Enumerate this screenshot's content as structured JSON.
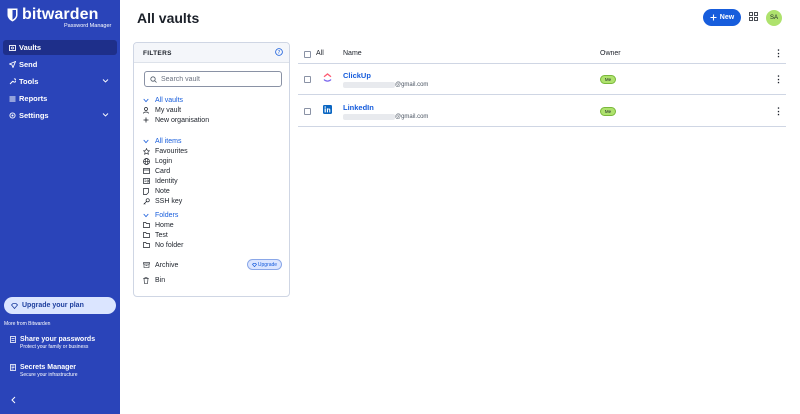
{
  "brand": {
    "name": "bitwarden",
    "subtitle": "Password Manager"
  },
  "sidebar": {
    "items": [
      {
        "label": "Vaults",
        "icon": "vault-icon",
        "active": true
      },
      {
        "label": "Send",
        "icon": "send-icon"
      },
      {
        "label": "Tools",
        "icon": "tools-icon",
        "expandable": true
      },
      {
        "label": "Reports",
        "icon": "reports-icon"
      },
      {
        "label": "Settings",
        "icon": "gear-icon",
        "expandable": true
      }
    ],
    "upgrade_label": "Upgrade your plan",
    "more_from": "More from Bitwarden",
    "promos": [
      {
        "title": "Share your passwords",
        "subtitle": "Protect your family or business"
      },
      {
        "title": "Secrets Manager",
        "subtitle": "Secure your infrastructure"
      }
    ]
  },
  "header": {
    "title": "All vaults",
    "new_label": "New",
    "avatar_initials": "SA"
  },
  "filters": {
    "title": "FILTERS",
    "search_placeholder": "Search vault",
    "vaults_group": "All vaults",
    "vaults": [
      "My vault",
      "New organisation"
    ],
    "items_group": "All items",
    "items": [
      "Favourites",
      "Login",
      "Card",
      "Identity",
      "Note",
      "SSH key"
    ],
    "folders_group": "Folders",
    "folders": [
      "Home",
      "Test",
      "No folder"
    ],
    "archive": "Archive",
    "upgrade_badge": "Upgrade",
    "bin": "Bin"
  },
  "table": {
    "headers": {
      "all": "All",
      "name": "Name",
      "owner": "Owner"
    },
    "rows": [
      {
        "name": "ClickUp",
        "email": "@gmail.com",
        "owner": "Me",
        "icon": "clickup-icon"
      },
      {
        "name": "LinkedIn",
        "email": "@gmail.com",
        "owner": "Me",
        "icon": "linkedin-icon"
      }
    ]
  },
  "colors": {
    "sidebar": "#2a44b9",
    "accent": "#175ddc",
    "owner_badge": "#aee26d"
  }
}
